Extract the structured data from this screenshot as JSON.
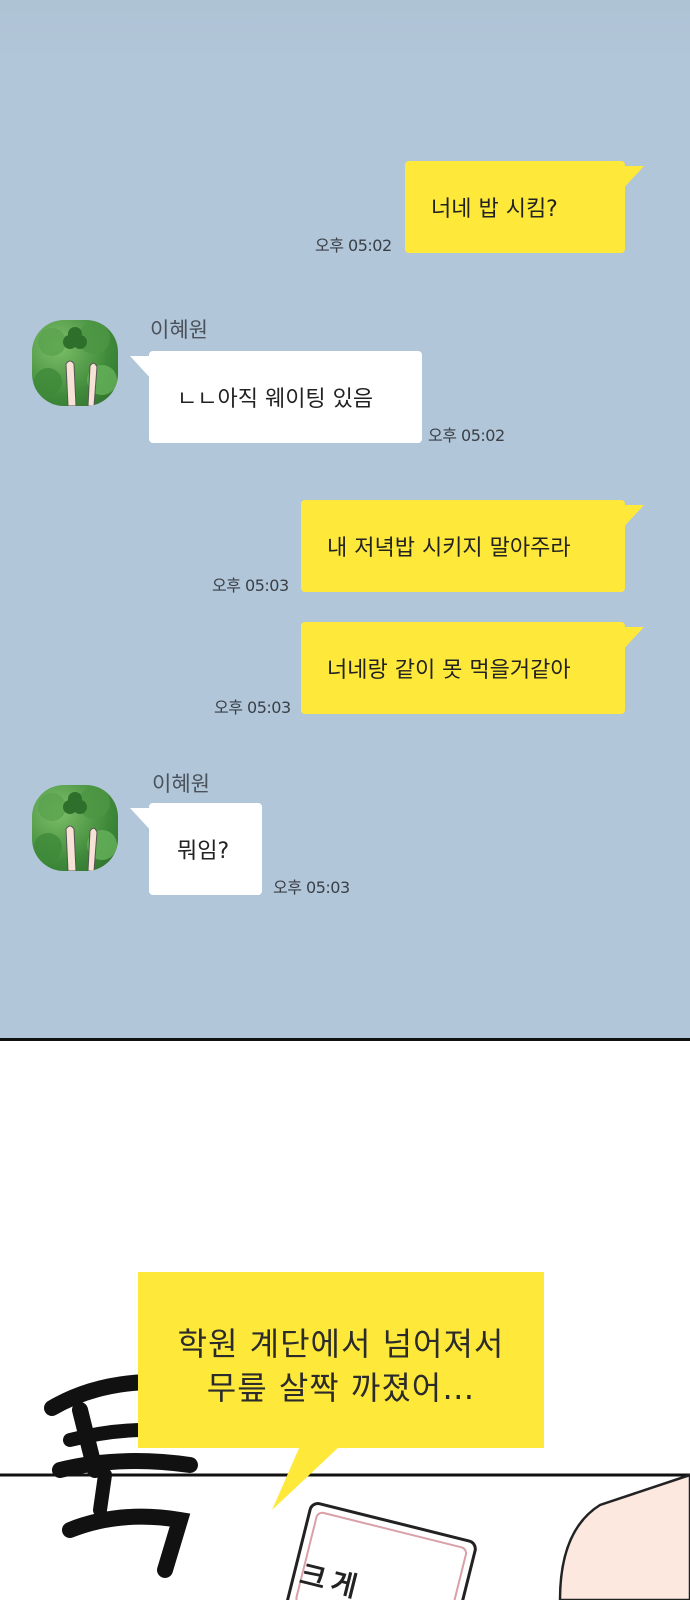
{
  "chat": {
    "contact_name": "이혜원",
    "messages": [
      {
        "side": "out",
        "text": "너네 밥 시킴?",
        "time": "오후 05:02"
      },
      {
        "side": "in",
        "text": "ㄴㄴ아직 웨이팅 있음",
        "time": "오후 05:02"
      },
      {
        "side": "out",
        "text": "내 저녁밥 시키지 말아주라",
        "time": "오후 05:03"
      },
      {
        "side": "out",
        "text": "너네랑 같이 못 먹을거같아",
        "time": "오후 05:03"
      },
      {
        "side": "in",
        "text": "뭐임?",
        "time": "오후 05:03"
      }
    ]
  },
  "scene": {
    "speech_line1": "학원 계단에서 넘어져서",
    "speech_line2": "무릎 살짝 까졌어…",
    "sfx": "툭",
    "sign_partial": "크게"
  },
  "colors": {
    "chat_background": "#b1c6d8",
    "outgoing_bubble": "#fee93a",
    "incoming_bubble": "#ffffff",
    "speech_bubble": "#fee93a"
  }
}
